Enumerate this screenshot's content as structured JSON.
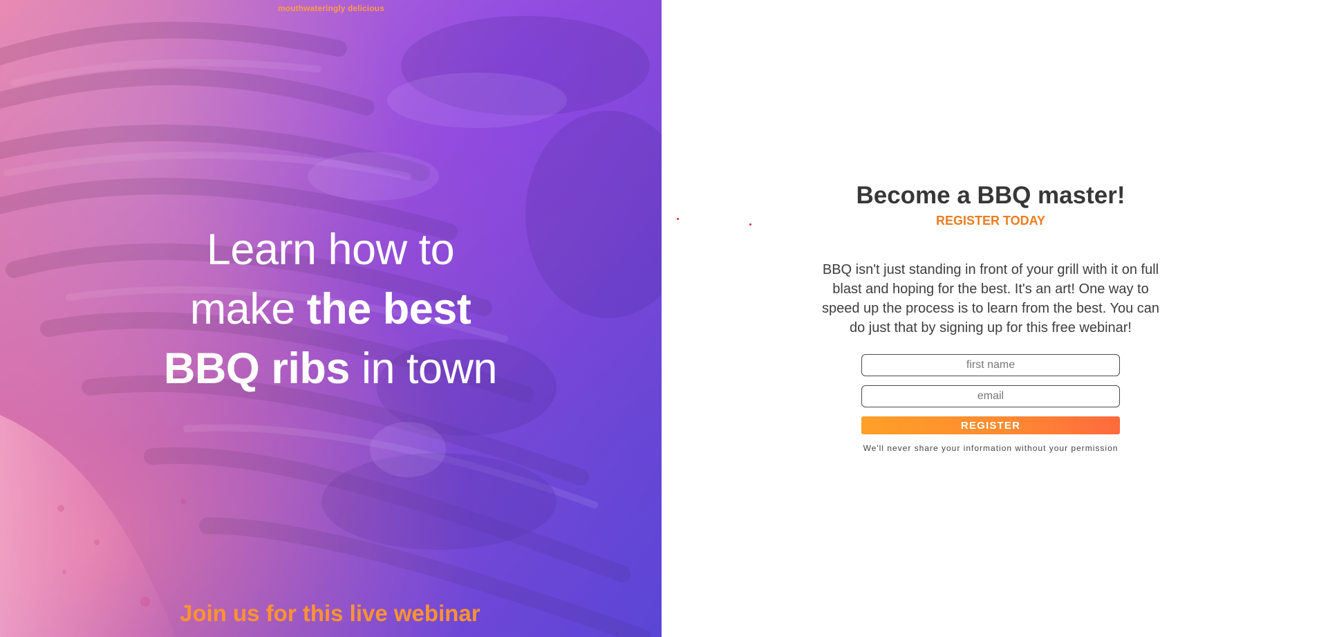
{
  "hero": {
    "tagline": "mouthwateringly delicious",
    "heading": {
      "line1": "Learn how to",
      "line2_light": "make",
      "line2_bold": "the best",
      "line3_bold": "BBQ ribs",
      "line3_light": "in town"
    },
    "callout": "Join us for this live webinar"
  },
  "panel": {
    "title": "Become a BBQ master!",
    "subtitle": "REGISTER TODAY",
    "description": "BBQ isn't just standing in front of your grill with it on full blast and hoping for the best. It's an art! One way to speed up the process is to learn from the best. You can do just that by signing up for this free webinar!",
    "form": {
      "first_name_placeholder": "first name",
      "email_placeholder": "email",
      "button_label": "REGISTER"
    },
    "privacy_note": "We'll never share your information without your permission"
  },
  "colors": {
    "accent_orange": "#e97d1f",
    "button_start": "#ffa027",
    "button_end": "#ff6a3d",
    "hero_purple": "#7b4dea",
    "hero_pink": "#d46192"
  },
  "icons": {
    "decorative": "red-dot"
  }
}
